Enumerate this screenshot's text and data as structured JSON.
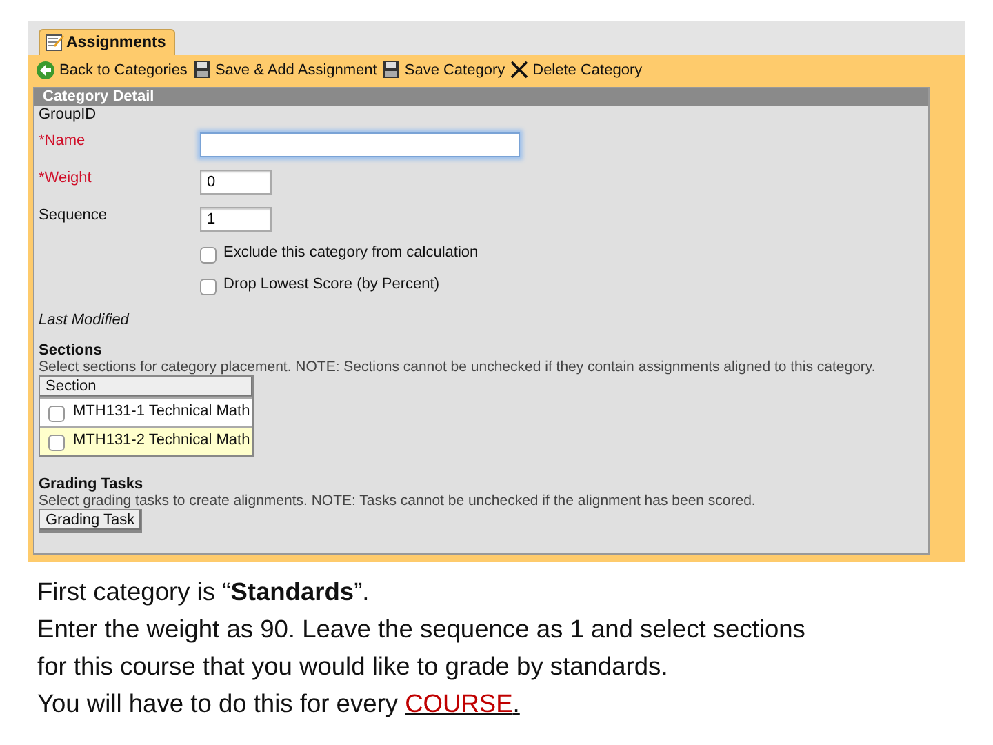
{
  "tab": {
    "label": "Assignments",
    "selected": true
  },
  "toolbar": [
    {
      "kind": "back",
      "label": "Back to Categories"
    },
    {
      "kind": "save",
      "label": "Save & Add Assignment"
    },
    {
      "kind": "save",
      "label": "Save Category"
    },
    {
      "kind": "delete",
      "label": "Delete Category"
    }
  ],
  "panel": {
    "title": "Category Detail",
    "fields": [
      {
        "kind": "label",
        "label": "GroupID"
      },
      {
        "kind": "text",
        "label": "*Name",
        "required": true,
        "focused": true
      },
      {
        "kind": "number",
        "label": "*Weight",
        "required": true,
        "focused": false,
        "value": "0"
      },
      {
        "kind": "number",
        "label": "Sequence",
        "required": false,
        "focused": false,
        "value": "1"
      },
      {
        "kind": "checkbox",
        "label": "Exclude this category from calculation",
        "checked": false
      },
      {
        "kind": "checkbox",
        "label": "Drop Lowest Score (by Percent)",
        "checked": false
      },
      {
        "kind": "note",
        "label": "Last Modified"
      }
    ],
    "sections": {
      "title": "Sections",
      "note": "Select sections for category placement. NOTE: Sections cannot be unchecked if they contain assignments aligned to this category.",
      "column": "Section",
      "rows": [
        {
          "label": "MTH131-1 Technical Math",
          "checked": false,
          "selected": false
        },
        {
          "label": "MTH131-2 Technical Math",
          "checked": false,
          "selected": true
        }
      ]
    },
    "grading": {
      "title": "Grading Tasks",
      "note": "Select grading tasks to create alignments. NOTE: Tasks cannot be unchecked if the alignment has been scored.",
      "column": "Grading Task"
    }
  },
  "caption": [
    {
      "text": "First category is “**Standards**”."
    },
    {
      "text": "Enter the weight as 90.  Leave the sequence as 1 and select sections"
    },
    {
      "text": "for this course that you would like to grade by standards."
    },
    {
      "text": "You will have to do this for every ",
      "highlight": "COURSE",
      "end": "."
    }
  ]
}
